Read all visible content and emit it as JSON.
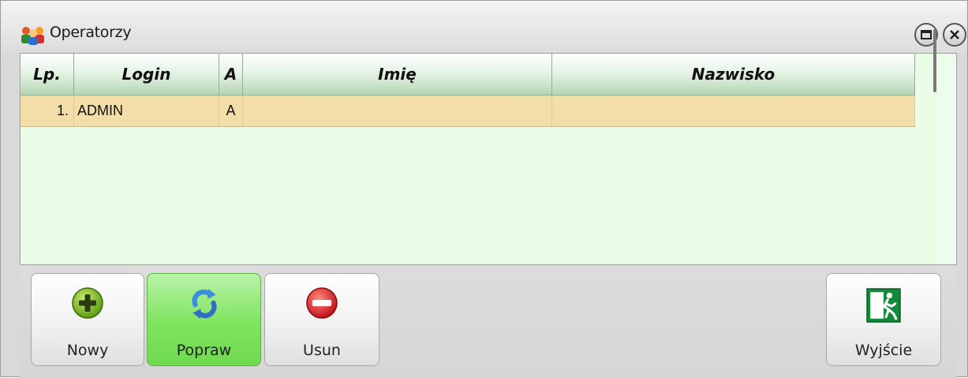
{
  "window": {
    "title": "Operatorzy",
    "icon": "users-group-icon"
  },
  "grid": {
    "columns": [
      {
        "key": "lp",
        "label": "Lp."
      },
      {
        "key": "login",
        "label": "Login"
      },
      {
        "key": "a",
        "label": "A"
      },
      {
        "key": "imie",
        "label": "Imię"
      },
      {
        "key": "nazwisko",
        "label": "Nazwisko"
      }
    ],
    "rows": [
      {
        "lp": "1.",
        "login": "ADMIN",
        "a": "A",
        "imie": "",
        "nazwisko": ""
      }
    ]
  },
  "toolbar": {
    "new_label": "Nowy",
    "edit_label": "Popraw",
    "delete_label": "Usun",
    "exit_label": "Wyjście"
  },
  "colors": {
    "grid_background": "#e9fde7",
    "selected_row": "#f3deaa",
    "active_button": "#7ee45e"
  }
}
